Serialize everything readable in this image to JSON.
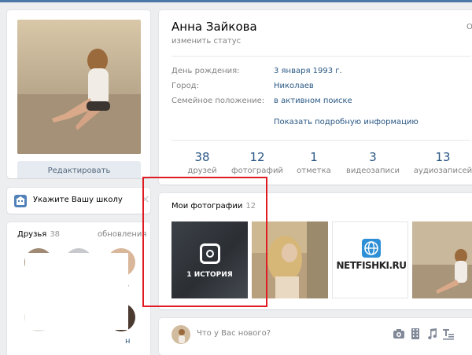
{
  "profile": {
    "name": "Анна Зайкова",
    "status_link": "изменить статус",
    "online_partial": "Or",
    "info": [
      {
        "label": "День рождения:",
        "value": "3 января 1993 г."
      },
      {
        "label": "Город:",
        "value": "Николаев"
      },
      {
        "label": "Семейное положение:",
        "value": "в активном поиске"
      }
    ],
    "more_info": "Показать подробную информацию",
    "counters": [
      {
        "num": "38",
        "label": "друзей"
      },
      {
        "num": "12",
        "label": "фотографий"
      },
      {
        "num": "1",
        "label": "отметка"
      },
      {
        "num": "3",
        "label": "видеозаписи"
      },
      {
        "num": "13",
        "label": "аудиозаписей"
      }
    ]
  },
  "sidebar": {
    "edit_button": "Редактировать",
    "school_prompt": "Укажите Вашу школу",
    "school_close": "×",
    "friends_title": "Друзья",
    "friends_count": "38",
    "friends_updates": "обновления",
    "friend_name_partial_1": "г",
    "friend_name_partial_2": "н"
  },
  "photos": {
    "title": "Мои фотографии",
    "count": "12",
    "story_label": "1 ИСТОРИЯ",
    "netfishki_text": "NETFISHKI.RU"
  },
  "post": {
    "placeholder": "Что у Вас нового?"
  },
  "icons": [
    "school-icon",
    "close-icon",
    "camera-icon",
    "video-icon",
    "music-icon",
    "text-format-icon",
    "globe-icon"
  ],
  "colors": {
    "accent": "#4a76a8",
    "link": "#2a5885",
    "highlight": "#e11b22"
  }
}
